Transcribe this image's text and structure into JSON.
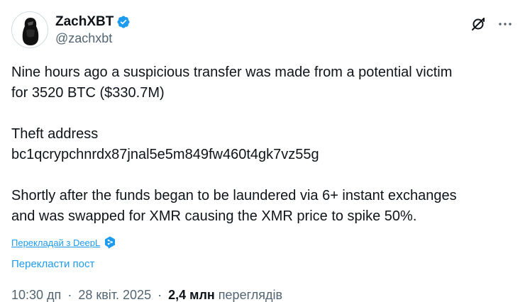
{
  "author": {
    "display_name": "ZachXBT",
    "handle": "@zachxbt",
    "verified": true,
    "avatar": "avatar-figure-icon"
  },
  "actions": {
    "grok_icon": "grok-icon",
    "more_icon": "more-icon"
  },
  "tweet": {
    "lines": [
      "Nine hours ago a suspicious transfer was made from a potential victim",
      "for 3520 BTC ($330.7M)",
      "Theft address",
      "bc1qcrypchnrdx87jnal5e5m849fw460t4gk7vz55g",
      "Shortly after the funds began to be laundered via 6+ instant exchanges",
      "and was swapped for XMR causing the XMR price to spike 50%."
    ]
  },
  "translation": {
    "deepl_label": "Перекладай з DeepL",
    "translate_label": "Перекласти пост"
  },
  "meta": {
    "time": "10:30 дп",
    "separator1": "·",
    "date": "28 квіт. 2025",
    "separator2": "·",
    "views_count": "2,4 млн",
    "views_label": "переглядів"
  },
  "colors": {
    "link": "#1d9bf0",
    "text": "#0f1419",
    "secondary": "#536471",
    "verified": "#1d9bf0"
  }
}
